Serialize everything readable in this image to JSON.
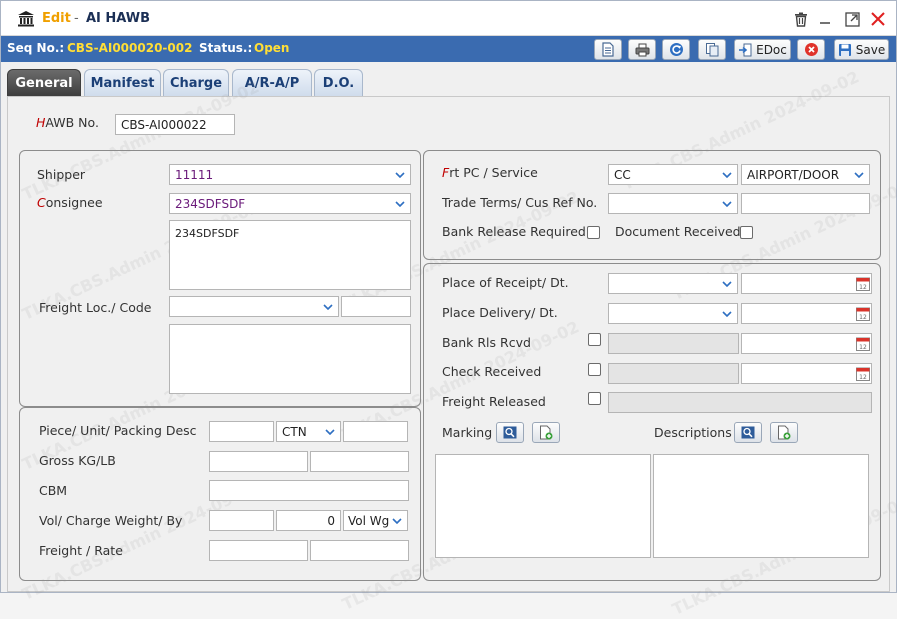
{
  "window": {
    "mode": "Edit",
    "separator": "-",
    "title": "AI HAWB"
  },
  "seqbar": {
    "seq_label": "Seq No.:",
    "seq_value": "CBS-AI000020-002",
    "status_label": "Status.:",
    "status_value": "Open",
    "edoc_label": "EDoc",
    "save_label": "Save"
  },
  "tabs": [
    {
      "label": "General",
      "active": true
    },
    {
      "label": "Manifest",
      "active": false
    },
    {
      "label": "Charge",
      "active": false
    },
    {
      "label": "A/R-A/P",
      "active": false
    },
    {
      "label": "D.O.",
      "active": false
    }
  ],
  "hawb": {
    "label_first": "H",
    "label_rest": "AWB No.",
    "value": "CBS-AI000022"
  },
  "left_panel": {
    "shipper_label": "Shipper",
    "shipper_value": "11111",
    "consignee_label_first": "C",
    "consignee_label_rest": "onsignee",
    "consignee_value": "234SDFSDF",
    "consignee_address": "234SDFSDF",
    "freight_loc_label": "Freight Loc./ Code",
    "freight_loc_value": "",
    "freight_code_value": "",
    "freight_loc_address": ""
  },
  "lower_left": {
    "piece_label": "Piece/  Unit/  Packing Desc",
    "piece_value": "",
    "unit_value": "CTN",
    "packing_value": "",
    "gross_label": "Gross  KG/LB",
    "gross_kg": "",
    "gross_lb": "",
    "cbm_label": "CBM",
    "cbm_value": "",
    "vol_label": "Vol/  Charge Weight/  By",
    "vol_value": "",
    "charge_weight": "0",
    "by_value": "Vol Wg",
    "freight_rate_label": "Freight / Rate",
    "freight_value": "",
    "rate_value": ""
  },
  "right_top": {
    "frt_label_first": "F",
    "frt_label_rest": "rt PC / Service",
    "frt_pc": "CC",
    "service": "AIRPORT/DOOR",
    "trade_label": "Trade Terms/ Cus Ref No.",
    "trade_value": "",
    "cus_ref": "",
    "bank_release_label": "Bank Release Required",
    "document_received_label": "Document Received"
  },
  "right_bottom": {
    "receipt_label": "Place of Receipt/ Dt.",
    "delivery_label": "Place Delivery/ Dt.",
    "bank_rls_label": "Bank Rls Rcvd",
    "check_received_label": "Check Received",
    "freight_released_label": "Freight Released",
    "marking_label": "Marking",
    "descriptions_label": "Descriptions"
  },
  "watermark": "TLKA.CBS.Admin 2024-09-02",
  "colors": {
    "accent_blue": "#3a6bb0",
    "seq_value": "#ffde36",
    "edit_orange": "#f0a000",
    "required_red": "#c00000",
    "consignee_purple": "#6a1a7a",
    "close_red": "#e02020"
  }
}
